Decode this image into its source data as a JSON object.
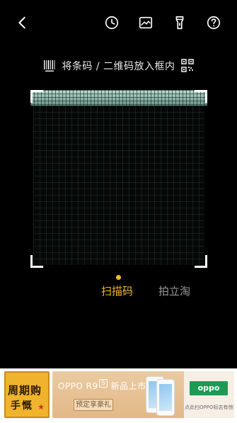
{
  "toolbar": {
    "back_icon": "chevron-left-icon",
    "history_icon": "clock-icon",
    "gallery_icon": "image-icon",
    "torch_icon": "flashlight-icon",
    "help_icon": "help-icon"
  },
  "hint": {
    "text": "将条码 / 二维码放入框内",
    "left_icon": "barcode-icon",
    "right_icon": "qrcode-icon"
  },
  "scanner": {
    "frame_icon": "scan-frame"
  },
  "modes": {
    "active": "扫描码",
    "inactive": "拍立淘",
    "indicator_color": "#f3b92c"
  },
  "ad": {
    "left_line1": "周期购",
    "left_line2": "手慨",
    "left_mark": "★",
    "title": "OPPO R9",
    "title_badge": "S",
    "title_suffix": "新品上市",
    "button": "预定享豪礼",
    "logo": "oppo",
    "note": "点此扫OPPO标志有惊喜"
  }
}
